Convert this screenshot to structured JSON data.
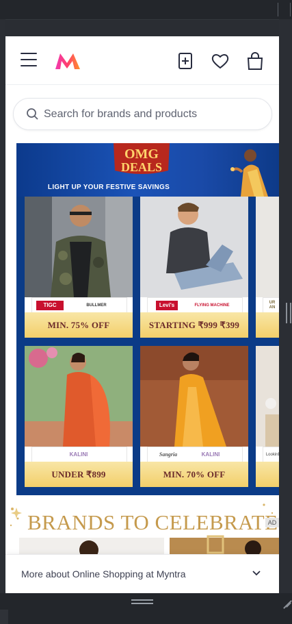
{
  "header": {
    "menu_icon": "hamburger-icon",
    "logo": "myntra-logo",
    "icons": [
      "add-to-home-icon",
      "wishlist-heart-icon",
      "bag-icon"
    ]
  },
  "search": {
    "placeholder": "Search for brands and products"
  },
  "banner": {
    "headline_line1": "OMG",
    "headline_line2": "DEALS",
    "tagline": "LIGHT UP YOUR FESTIVE SAVINGS"
  },
  "tiles": [
    {
      "brands": [
        "TIGC",
        "BULLMER"
      ],
      "offer": "MIN. 75% OFF"
    },
    {
      "brands": [
        "Levi's",
        "FLYING MACHINE"
      ],
      "offer": "STARTING ₹999 ₹399"
    },
    {
      "brands": [
        "UR",
        "AN"
      ],
      "offer": ""
    },
    {
      "brands": [
        "KALINI"
      ],
      "offer": "UNDER ₹899"
    },
    {
      "brands": [
        "Sangria",
        "KALINI"
      ],
      "offer": "MIN. 70% OFF"
    },
    {
      "brands": [
        "LookinBeauty"
      ],
      "offer": ""
    }
  ],
  "section": {
    "title": "BRANDS TO CELEBRATE",
    "ad_badge": "AD"
  },
  "footer": {
    "text": "More about Online Shopping at Myntra"
  },
  "colors": {
    "brand_pink": "#ff3f6c",
    "banner_blue": "#0b3b87",
    "offer_gold": "#f3cf6a",
    "celebrate_gold": "#c59a4d"
  }
}
